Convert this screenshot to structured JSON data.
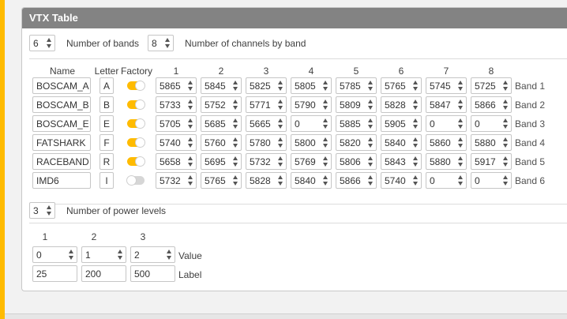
{
  "panel": {
    "title": "VTX Table"
  },
  "bands_count": {
    "value": "6",
    "label": "Number of bands"
  },
  "channels_count": {
    "value": "8",
    "label": "Number of channels by band"
  },
  "table": {
    "headers": {
      "name": "Name",
      "letter": "Letter",
      "factory": "Factory",
      "channels": [
        "1",
        "2",
        "3",
        "4",
        "5",
        "6",
        "7",
        "8"
      ]
    },
    "rows": [
      {
        "name": "BOSCAM_A",
        "letter": "A",
        "factory": true,
        "freqs": [
          "5865",
          "5845",
          "5825",
          "5805",
          "5785",
          "5765",
          "5745",
          "5725"
        ],
        "band_label": "Band 1"
      },
      {
        "name": "BOSCAM_B",
        "letter": "B",
        "factory": true,
        "freqs": [
          "5733",
          "5752",
          "5771",
          "5790",
          "5809",
          "5828",
          "5847",
          "5866"
        ],
        "band_label": "Band 2"
      },
      {
        "name": "BOSCAM_E",
        "letter": "E",
        "factory": true,
        "freqs": [
          "5705",
          "5685",
          "5665",
          "0",
          "5885",
          "5905",
          "0",
          "0"
        ],
        "band_label": "Band 3"
      },
      {
        "name": "FATSHARK",
        "letter": "F",
        "factory": true,
        "freqs": [
          "5740",
          "5760",
          "5780",
          "5800",
          "5820",
          "5840",
          "5860",
          "5880"
        ],
        "band_label": "Band 4"
      },
      {
        "name": "RACEBAND",
        "letter": "R",
        "factory": true,
        "freqs": [
          "5658",
          "5695",
          "5732",
          "5769",
          "5806",
          "5843",
          "5880",
          "5917"
        ],
        "band_label": "Band 5"
      },
      {
        "name": "IMD6",
        "letter": "I",
        "factory": false,
        "freqs": [
          "5732",
          "5765",
          "5828",
          "5840",
          "5866",
          "5740",
          "0",
          "0"
        ],
        "band_label": "Band 6"
      }
    ]
  },
  "power_levels_count": {
    "value": "3",
    "label": "Number of power levels"
  },
  "power": {
    "headers": [
      "1",
      "2",
      "3"
    ],
    "values": [
      "0",
      "1",
      "2"
    ],
    "labels": [
      "25",
      "200",
      "500"
    ],
    "value_row_label": "Value",
    "label_row_label": "Label"
  },
  "colors": {
    "accent": "#ffbb00",
    "header_bg": "#838383",
    "toggle_off": "#d6d6d6"
  }
}
